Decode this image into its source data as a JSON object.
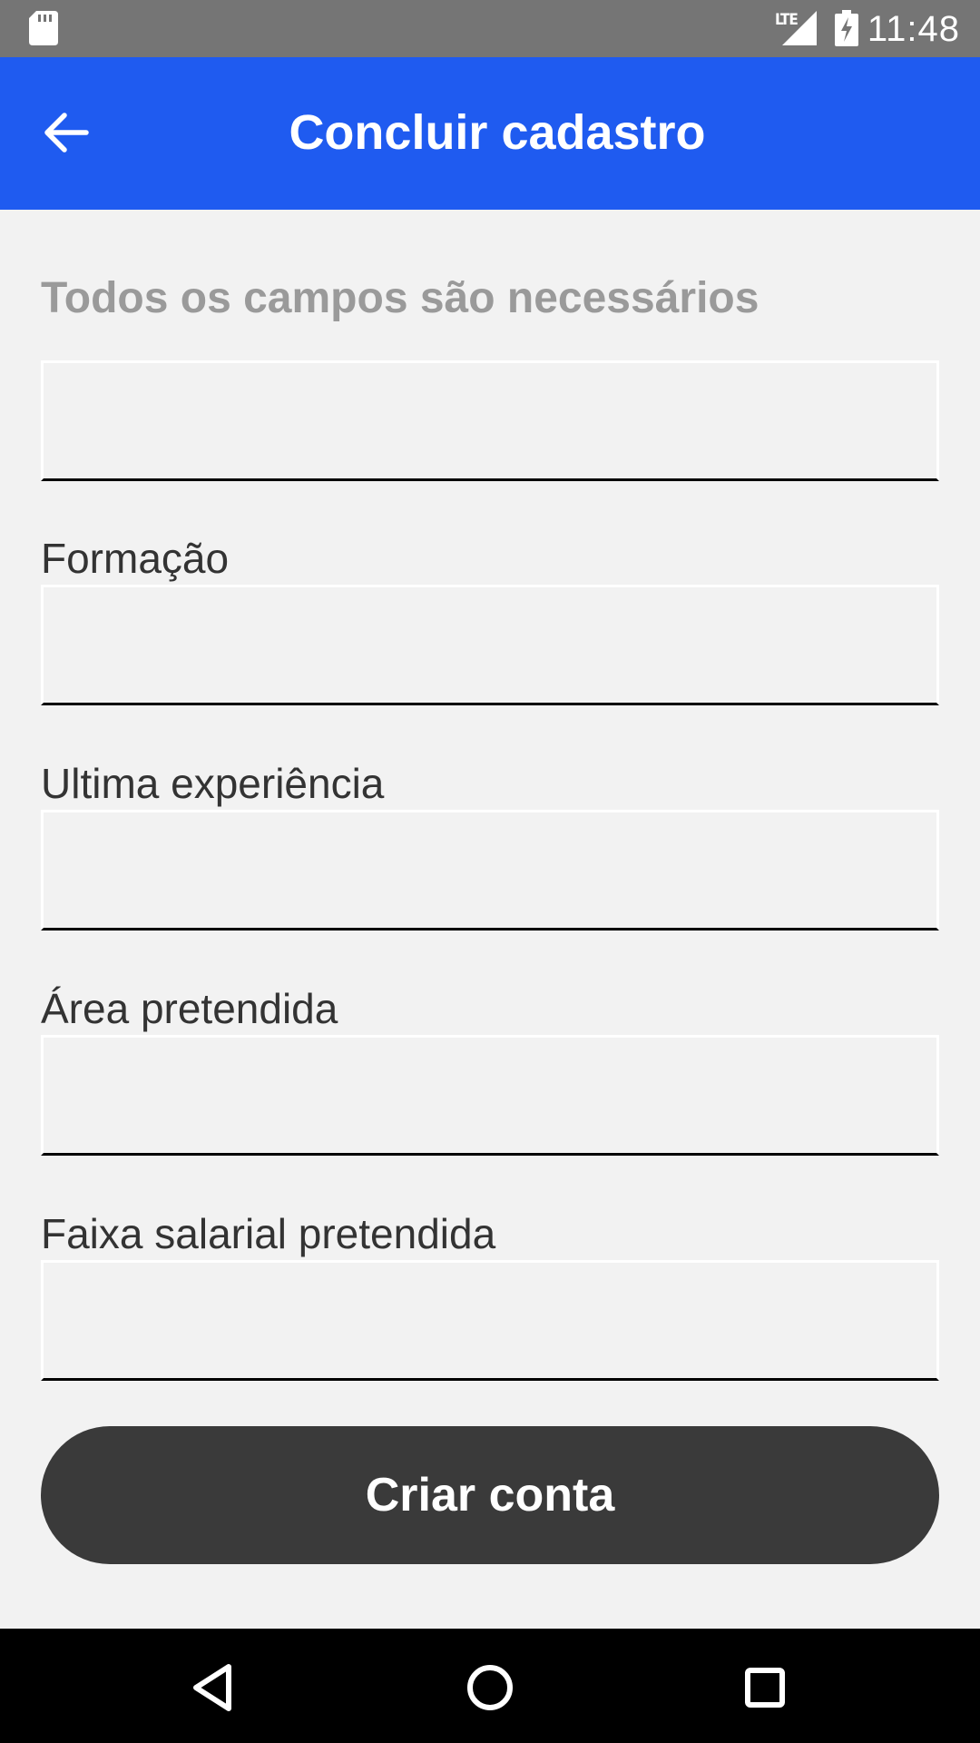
{
  "status_bar": {
    "time": "11:48",
    "network": "LTE",
    "icons": [
      "sd-card-icon",
      "signal-icon",
      "battery-charging-icon"
    ]
  },
  "app_bar": {
    "title": "Concluir cadastro",
    "back_icon": "arrow-back-icon",
    "color": "#1f5bf0"
  },
  "form": {
    "required_note": "Todos os campos são necessários",
    "fields": [
      {
        "label": "",
        "value": ""
      },
      {
        "label": "Formação",
        "value": ""
      },
      {
        "label": "Ultima experiência",
        "value": ""
      },
      {
        "label": "Área pretendida",
        "value": ""
      },
      {
        "label": "Faixa salarial pretendida",
        "value": ""
      }
    ],
    "submit_label": "Criar conta"
  },
  "nav_bar": {
    "icons": [
      "back-triangle-icon",
      "home-circle-icon",
      "recents-square-icon"
    ]
  }
}
